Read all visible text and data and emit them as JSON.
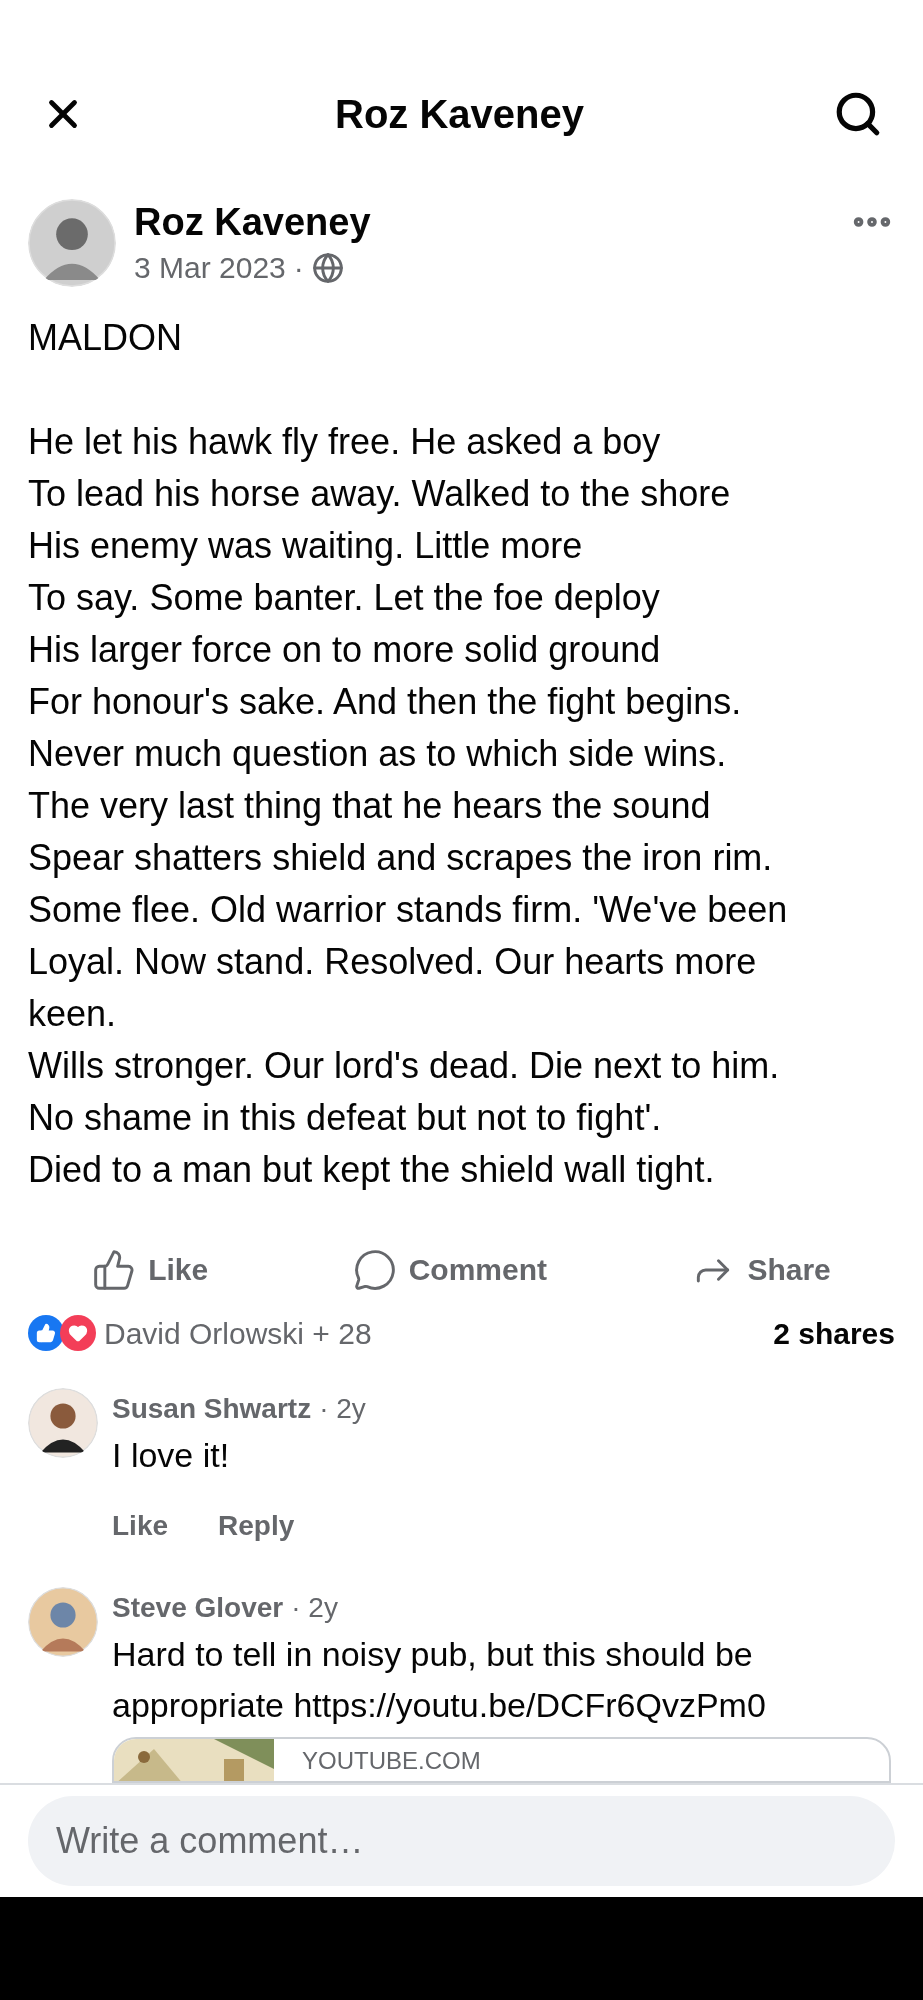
{
  "header": {
    "title": "Roz Kaveney"
  },
  "post": {
    "author": "Roz Kaveney",
    "date": "3 Mar 2023",
    "separator": "·",
    "title": "MALDON",
    "lines": [
      "He let his hawk fly free. He asked a boy",
      "To lead his horse away. Walked to the shore",
      "His enemy was waiting. Little more",
      "To say. Some banter. Let the foe deploy",
      "His larger force on to more solid ground",
      "For honour's sake. And then the fight begins.",
      "Never much question as to which side wins.",
      "The very last thing that he hears the sound",
      "Spear shatters shield and scrapes the iron rim.",
      "Some flee. Old warrior stands firm. 'We've been",
      "Loyal. Now stand. Resolved. Our hearts more keen.",
      "Wills stronger. Our lord's dead. Die next to him.",
      "No shame in this defeat but not to fight'.",
      "Died to a man but kept the shield wall tight."
    ]
  },
  "actions": [
    {
      "kind": "like",
      "label": "Like"
    },
    {
      "kind": "comment",
      "label": "Comment"
    },
    {
      "kind": "share",
      "label": "Share"
    }
  ],
  "reactions": {
    "summary": "David Orlowski + 28",
    "shares": "2 shares"
  },
  "comments": [
    {
      "author": "Susan Shwartz",
      "time": "· 2y",
      "text": "I love it!",
      "actions": [
        "Like",
        "Reply"
      ]
    },
    {
      "author": "Steve Glover",
      "time": "· 2y",
      "text": "Hard to tell in noisy pub, but this should be appropriate https://youtu.be/DCFr6QvzPm0",
      "preview": {
        "domain": "YOUTUBE.COM"
      }
    }
  ],
  "composer": {
    "placeholder": "Write a comment…"
  }
}
